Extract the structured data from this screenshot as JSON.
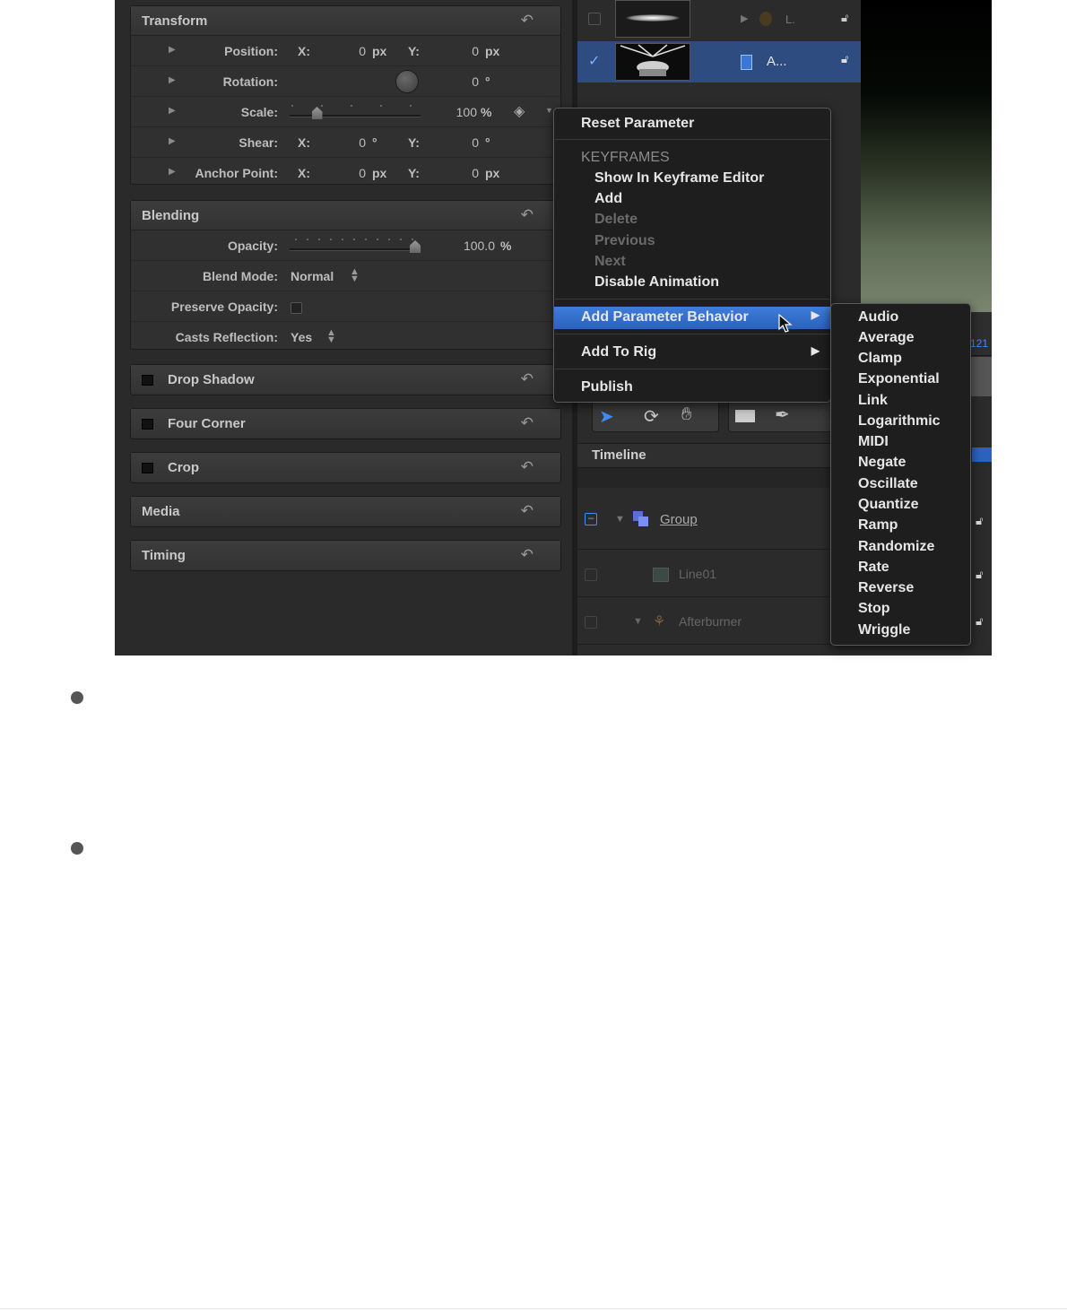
{
  "inspector": {
    "transform": {
      "title": "Transform",
      "position": {
        "label": "Position:",
        "x_label": "X:",
        "x_value": "0",
        "x_unit": "px",
        "y_label": "Y:",
        "y_value": "0",
        "y_unit": "px"
      },
      "rotation": {
        "label": "Rotation:",
        "value": "0",
        "unit": "°"
      },
      "scale": {
        "label": "Scale:",
        "value": "100",
        "unit": "%",
        "level": 0.25
      },
      "shear": {
        "label": "Shear:",
        "x_label": "X:",
        "x_value": "0",
        "x_unit": "°",
        "y_label": "Y:",
        "y_value": "0",
        "y_unit": "°"
      },
      "anchor": {
        "label": "Anchor Point:",
        "x_label": "X:",
        "x_value": "0",
        "x_unit": "px",
        "y_label": "Y:",
        "y_value": "0",
        "y_unit": "px"
      }
    },
    "blending": {
      "title": "Blending",
      "opacity": {
        "label": "Opacity:",
        "value": "100.0",
        "unit": "%",
        "level": 1.0
      },
      "blend_mode": {
        "label": "Blend Mode:",
        "value": "Normal"
      },
      "preserve_opacity": {
        "label": "Preserve Opacity:",
        "checked": false
      },
      "casts_reflection": {
        "label": "Casts Reflection:",
        "value": "Yes"
      }
    },
    "collapsed_panels": [
      {
        "title": "Drop Shadow",
        "has_checkbox": true
      },
      {
        "title": "Four Corner",
        "has_checkbox": true
      },
      {
        "title": "Crop",
        "has_checkbox": true
      },
      {
        "title": "Media",
        "has_checkbox": false
      },
      {
        "title": "Timing",
        "has_checkbox": false
      }
    ]
  },
  "layers": {
    "rows": [
      {
        "name": "L.",
        "checked": false,
        "selected": false
      },
      {
        "name": "A...",
        "checked": true,
        "selected": true
      }
    ]
  },
  "timeline": {
    "title": "Timeline",
    "rows": [
      {
        "name": "Group"
      },
      {
        "name": "Line01"
      },
      {
        "name": "Afterburner"
      }
    ]
  },
  "viewer": {
    "partial_value": "121"
  },
  "context_menu": {
    "reset": "Reset Parameter",
    "keyframes_header": "KEYFRAMES",
    "show_in_editor": "Show In Keyframe Editor",
    "add": "Add",
    "delete": "Delete",
    "previous": "Previous",
    "next": "Next",
    "disable_animation": "Disable Animation",
    "add_parameter_behavior": "Add Parameter Behavior",
    "add_to_rig": "Add To Rig",
    "publish": "Publish"
  },
  "submenu": {
    "items": [
      "Audio",
      "Average",
      "Clamp",
      "Exponential",
      "Link",
      "Logarithmic",
      "MIDI",
      "Negate",
      "Oscillate",
      "Quantize",
      "Ramp",
      "Randomize",
      "Rate",
      "Reverse",
      "Stop",
      "Wriggle"
    ]
  },
  "colors": {
    "highlight": "#3f7cd9",
    "panel_bg": "#2a2a2a",
    "menu_bg": "#1e1e1e"
  }
}
